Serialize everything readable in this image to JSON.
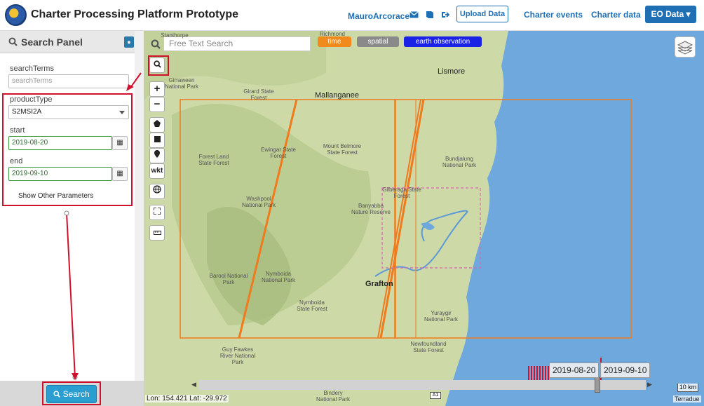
{
  "header": {
    "app_title": "Charter Processing Platform Prototype",
    "user": "MauroArcorace",
    "icons": [
      "envelope-icon",
      "book-icon",
      "sign-out-icon"
    ],
    "upload_label": "Upload Data",
    "nav": [
      "Charter events",
      "Charter data"
    ],
    "eo_label": "EO Data ▾"
  },
  "sidebar": {
    "title": "Search Panel",
    "fields": {
      "searchTerms_label": "searchTerms",
      "searchTerms_placeholder": "searchTerms",
      "productType_label": "productType",
      "productType_value": "S2MSI2A",
      "start_label": "start",
      "start_value": "2019-08-20",
      "end_label": "end",
      "end_value": "2019-09-10"
    },
    "other_params": "Show Other Parameters",
    "search_button": "Search"
  },
  "map": {
    "free_text_placeholder": "Free Text Search",
    "tags": [
      {
        "label": "time",
        "color": "#f08a1c"
      },
      {
        "label": "spatial",
        "color": "#8a8a8a"
      },
      {
        "label": "earth observation",
        "color": "#1a22e6"
      }
    ],
    "tools": {
      "zoom_in": "+",
      "zoom_out": "−",
      "wkt": "wkt"
    },
    "places": {
      "lismore": "Lismore",
      "mallanganee": "Mallanganee",
      "grafton": "Grafton",
      "stanthorpe": "Stanthorpe",
      "richmond": "Richmond",
      "girard": "Girard State Forest",
      "girraween": "Girraween National Park",
      "forest_land": "Forest Land State Forest",
      "ewingar": "Ewingar State Forest",
      "mount_belmore": "Mount Belmore State Forest",
      "washpool": "Washpool National Park",
      "banyabba": "Banyabba Nature Reserve",
      "gilbaringa": "Gilberaga State Forest",
      "bundjalung": "Bundjalung National Park",
      "barool": "Barool National Park",
      "nymboida_np": "Nymboida National Park",
      "nymboida_sf": "Nymboida State Forest",
      "yuraygir": "Yuraygir National Park",
      "guy_fawkes": "Guy Fawkes River National Park",
      "newfoundland": "Newfoundland State Forest",
      "bindery": "Bindery National Park",
      "road": "A1"
    },
    "timeline_dates": [
      "2019-08-20",
      "2019-09-10"
    ],
    "coords": "Lon: 154.421 Lat: -29.972",
    "scale": "10 km",
    "attribution": "Terradue",
    "colors": {
      "footprint": "#f07a1c",
      "highlight": "#d0112b",
      "sea": "#6fa8dc"
    }
  }
}
